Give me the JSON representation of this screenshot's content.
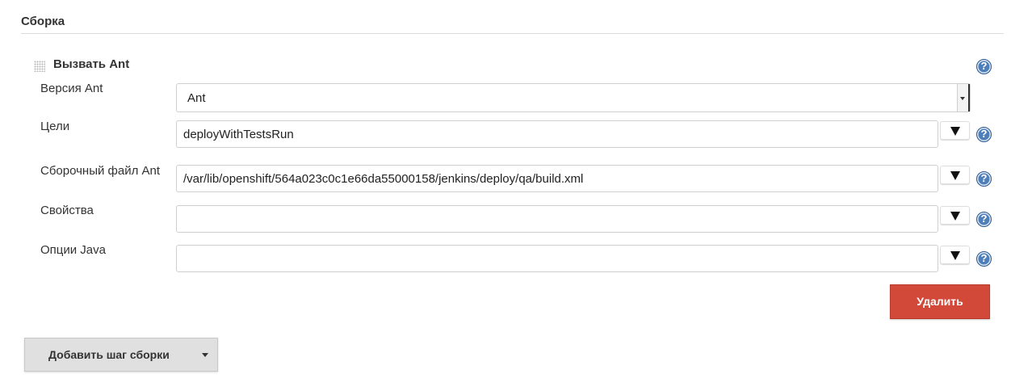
{
  "section": {
    "title": "Сборка"
  },
  "step": {
    "title": "Вызвать Ant",
    "help_glyph": "?",
    "fields": [
      {
        "label": "Версия Ant",
        "type": "select",
        "value": "Ant"
      },
      {
        "label": "Цели",
        "type": "text",
        "value": "deployWithTestsRun"
      },
      {
        "label": "Сборочный файл Ant",
        "type": "text",
        "value": "/var/lib/openshift/564a023c0c1e66da55000158/jenkins/deploy/qa/build.xml"
      },
      {
        "label": "Свойства",
        "type": "text",
        "value": ""
      },
      {
        "label": "Опции Java",
        "type": "text",
        "value": ""
      }
    ],
    "delete_label": "Удалить"
  },
  "add_step": {
    "label": "Добавить шаг сборки"
  },
  "icons": {
    "help": "help-icon",
    "expand": "expand-triangle-icon",
    "drag": "drag-handle-icon",
    "dropdown": "chevron-down-icon"
  },
  "colors": {
    "help_icon": "#4f7fb8",
    "delete_button": "#d24939",
    "add_step_button": "#e0e0e0"
  }
}
